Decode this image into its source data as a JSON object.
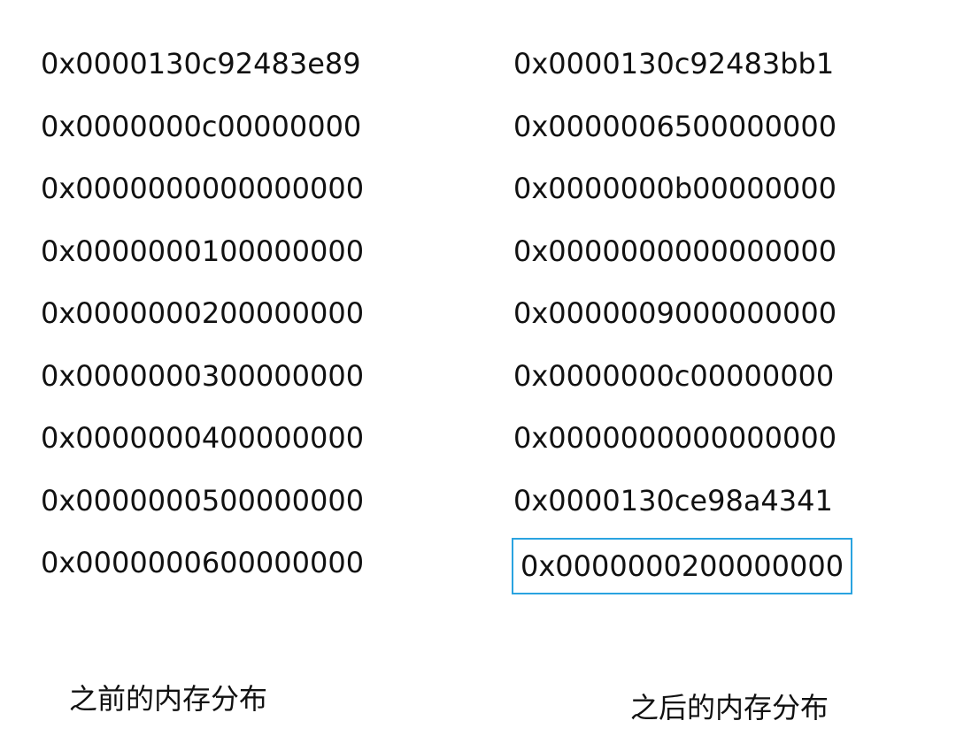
{
  "before": {
    "caption": "之前的内存分布",
    "values": [
      "0x0000130c92483e89",
      "0x0000000c00000000",
      "0x0000000000000000",
      "0x0000000100000000",
      "0x0000000200000000",
      "0x0000000300000000",
      "0x0000000400000000",
      "0x0000000500000000",
      "0x0000000600000000"
    ]
  },
  "after": {
    "caption": "之后的内存分布",
    "values": [
      "0x0000130c92483bb1",
      "0x0000006500000000",
      "0x0000000b00000000",
      "0x0000000000000000",
      "0x0000009000000000",
      "0x0000000c00000000",
      "0x0000000000000000",
      "0x0000130ce98a4341",
      "0x0000000200000000"
    ],
    "highlight_color": "#2aa3e0"
  }
}
